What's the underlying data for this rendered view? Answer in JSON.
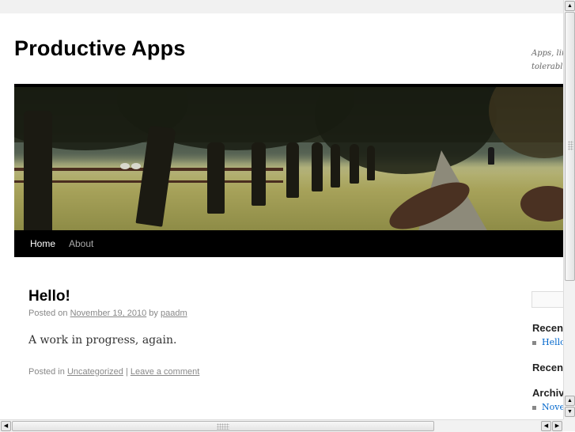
{
  "site": {
    "title": "Productive Apps",
    "description_line1": "Apps, lin",
    "description_line2": "tolerable"
  },
  "nav": {
    "items": [
      {
        "label": "Home",
        "current": true
      },
      {
        "label": "About",
        "current": false
      }
    ]
  },
  "post": {
    "title": "Hello!",
    "posted_on_label": "Posted on",
    "date": "November 19, 2010",
    "by_label": "by",
    "author": "paadm",
    "content": "A work in progress, again.",
    "posted_in_label": "Posted in",
    "category": "Uncategorized",
    "separator": "|",
    "comment_link": "Leave a comment"
  },
  "sidebar": {
    "search_placeholder": "",
    "widgets": [
      {
        "title": "Recen",
        "items": [
          "Hello!"
        ]
      },
      {
        "title": "Recen",
        "items": []
      },
      {
        "title": "Archiv",
        "items": [
          "Nove"
        ]
      }
    ]
  },
  "scrollbars": {
    "up_glyph": "▲",
    "down_glyph": "▼",
    "left_glyph": "◀",
    "right_glyph": "▶"
  }
}
